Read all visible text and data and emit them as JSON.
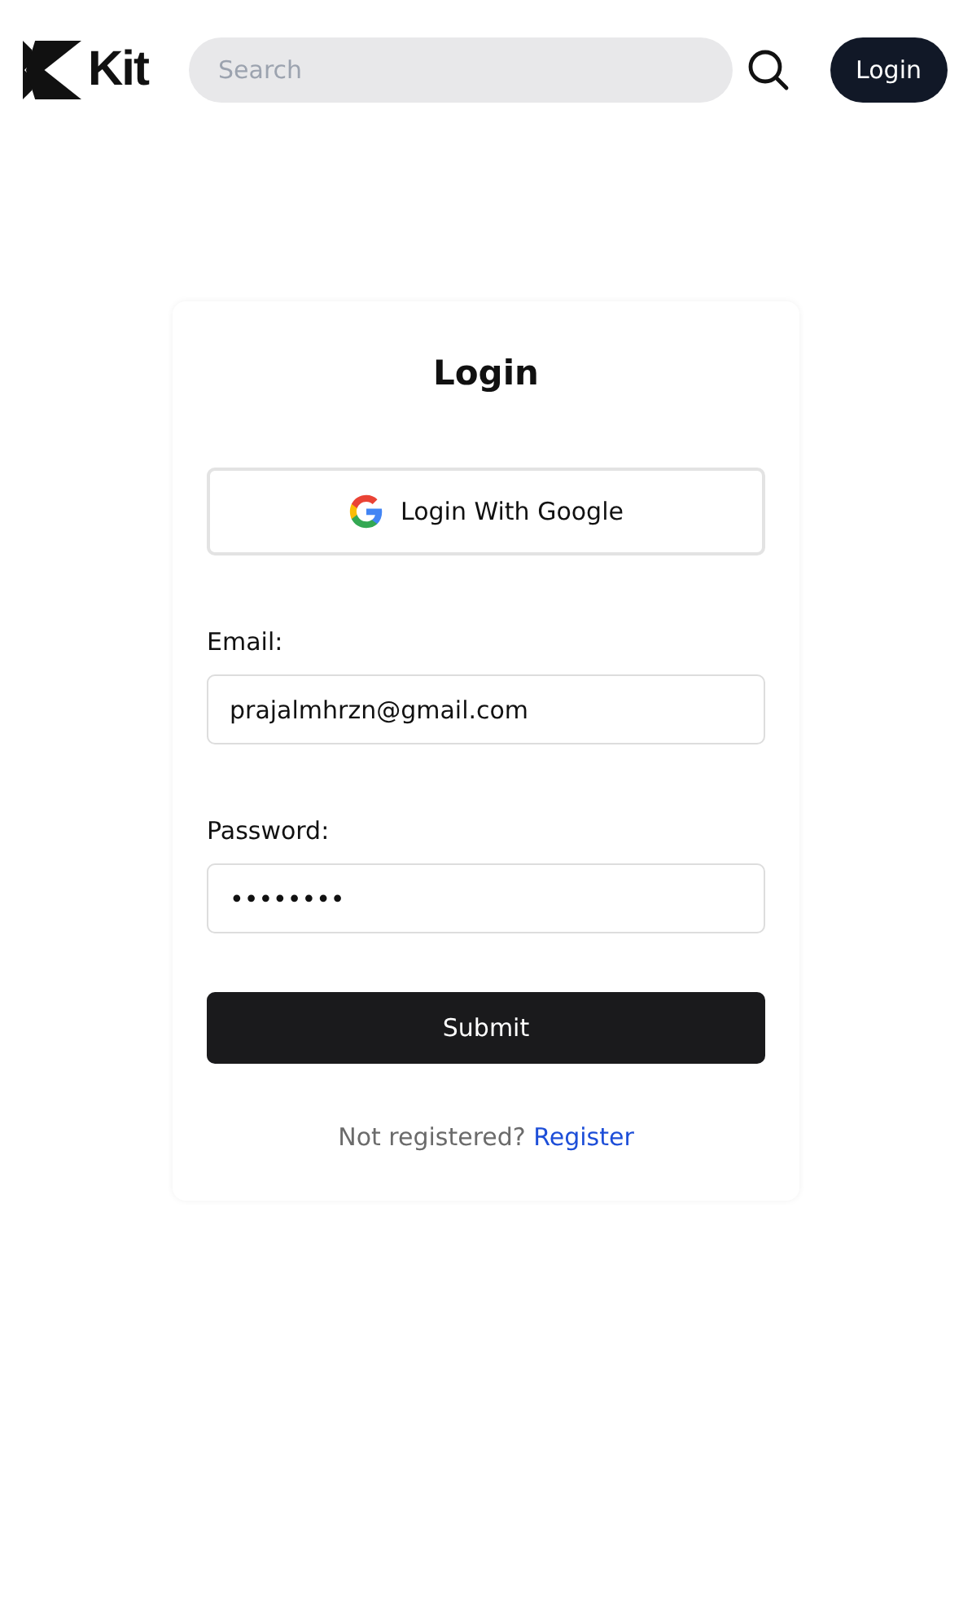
{
  "header": {
    "logo_text": "Kit",
    "search": {
      "placeholder": "Search"
    },
    "login_button": "Login"
  },
  "form": {
    "title": "Login",
    "google_button": "Login With Google",
    "fields": [
      {
        "label": "Email:",
        "value": "prajalmhrzn@gmail.com"
      },
      {
        "label": "Password:",
        "value": "••••••••"
      }
    ],
    "submit": "Submit",
    "footer_text": "Not registered?",
    "footer_link": "Register"
  }
}
